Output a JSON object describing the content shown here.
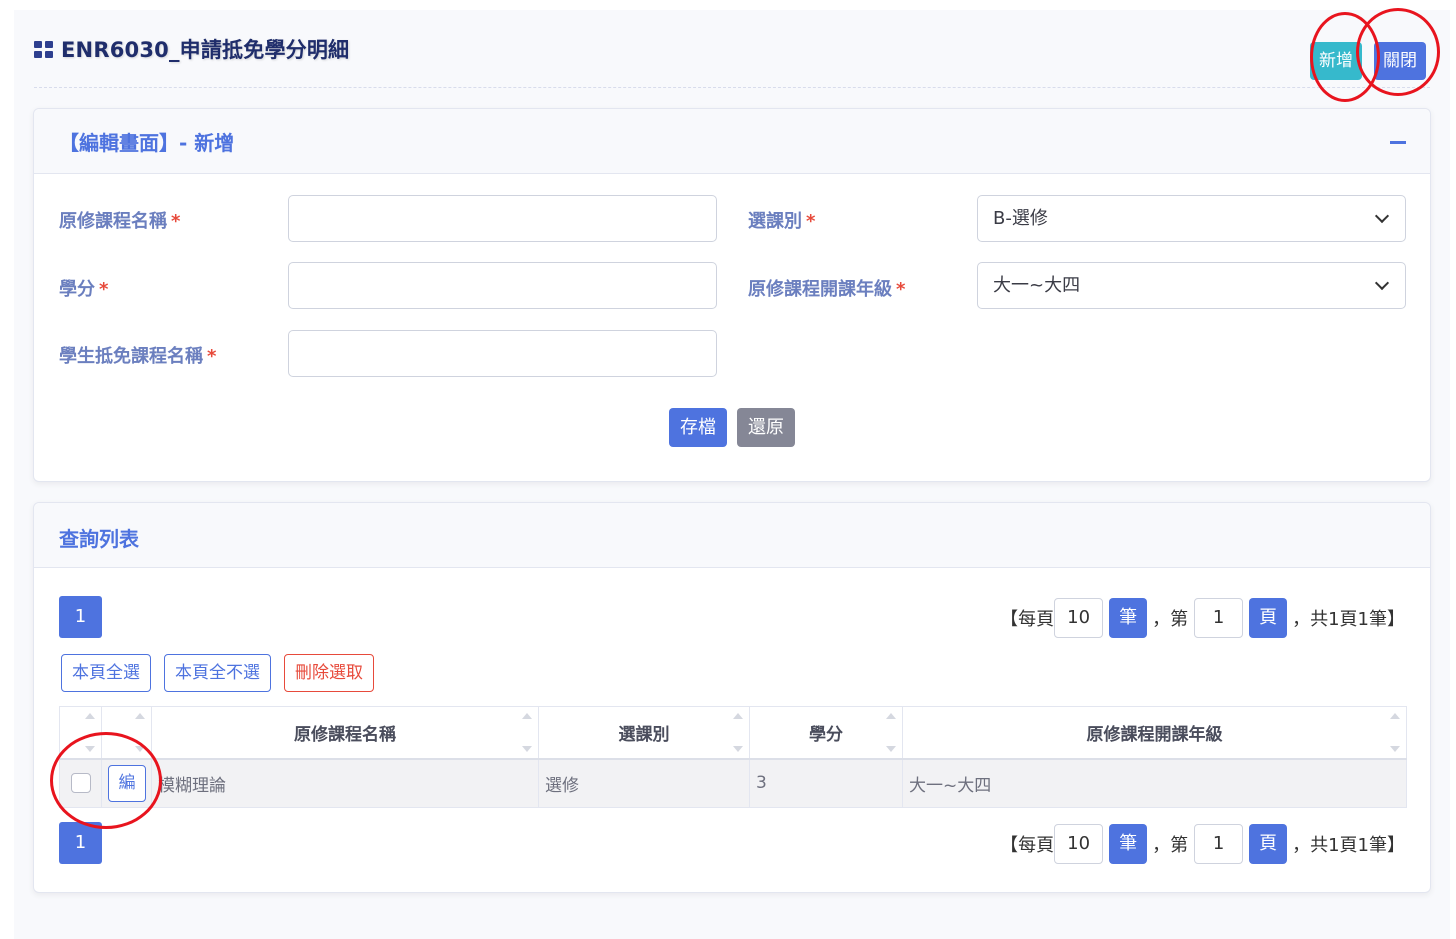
{
  "header": {
    "title": "ENR6030_申請抵免學分明細",
    "add_label": "新增",
    "close_label": "關閉"
  },
  "edit_panel": {
    "title": "【編輯畫面】- 新增",
    "fields": {
      "orig_course_label": "原修課程名稱",
      "credit_label": "學分",
      "waive_course_label": "學生抵免課程名稱",
      "course_type_label": "選課別",
      "course_type_value": "B-選修",
      "grade_label": "原修課程開課年級",
      "grade_value": "大一~大四",
      "required_mark": "*"
    },
    "save_label": "存檔",
    "reset_label": "還原"
  },
  "list_panel": {
    "title": "查詢列表",
    "page_button": "1",
    "pager": {
      "prefix": "【每頁",
      "per_page": "10",
      "per_page_btn": "筆",
      "page_prefix": "，第",
      "page": "1",
      "page_btn": "頁",
      "summary": "，共1頁1筆】"
    },
    "select_all_label": "本頁全選",
    "deselect_all_label": "本頁全不選",
    "delete_selected_label": "刪除選取",
    "columns": [
      "原修課程名稱",
      "選課別",
      "學分",
      "原修課程開課年級"
    ],
    "rows": [
      {
        "edit_label": "編",
        "course": "模糊理論",
        "type": "選修",
        "credit": "3",
        "grade": "大一~大四"
      }
    ]
  },
  "colors": {
    "primary": "#4e73df",
    "info": "#36b9cc",
    "secondary": "#858796",
    "danger": "#e74a3b",
    "annotation": "#e8141e"
  }
}
